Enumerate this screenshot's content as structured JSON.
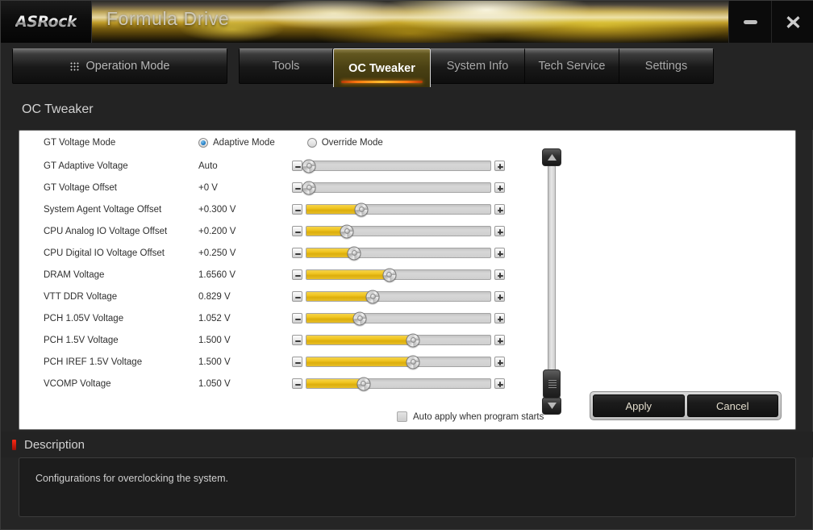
{
  "window": {
    "brand": "ASRock",
    "title": "Formula Drive",
    "minimize_label": "minimize",
    "close_label": "close"
  },
  "tabs": {
    "operation_mode": "Operation Mode",
    "items": [
      {
        "label": "Tools",
        "active": false
      },
      {
        "label": "OC Tweaker",
        "active": true
      },
      {
        "label": "System Info",
        "active": false
      },
      {
        "label": "Tech Service",
        "active": false
      },
      {
        "label": "Settings",
        "active": false
      }
    ]
  },
  "page": {
    "title": "OC Tweaker"
  },
  "mode_row": {
    "label": "GT Voltage Mode",
    "options": [
      {
        "label": "Adaptive Mode",
        "selected": true
      },
      {
        "label": "Override Mode",
        "selected": false
      }
    ]
  },
  "settings": [
    {
      "label": "GT Adaptive Voltage",
      "value": "Auto",
      "fill_pct": 0,
      "knob_pct": 1.5
    },
    {
      "label": "GT Voltage Offset",
      "value": "+0 V",
      "fill_pct": 0,
      "knob_pct": 1.5
    },
    {
      "label": "System Agent Voltage Offset",
      "value": "+0.300 V",
      "fill_pct": 30,
      "knob_pct": 30
    },
    {
      "label": "CPU Analog IO Voltage Offset",
      "value": "+0.200 V",
      "fill_pct": 22,
      "knob_pct": 22
    },
    {
      "label": "CPU Digital IO Voltage Offset",
      "value": "+0.250 V",
      "fill_pct": 26,
      "knob_pct": 26
    },
    {
      "label": "DRAM Voltage",
      "value": "1.6560 V",
      "fill_pct": 45,
      "knob_pct": 45
    },
    {
      "label": "VTT DDR Voltage",
      "value": "0.829 V",
      "fill_pct": 36,
      "knob_pct": 36
    },
    {
      "label": "PCH 1.05V Voltage",
      "value": "1.052 V",
      "fill_pct": 29,
      "knob_pct": 29
    },
    {
      "label": "PCH 1.5V Voltage",
      "value": "1.500 V",
      "fill_pct": 58,
      "knob_pct": 58
    },
    {
      "label": "PCH IREF 1.5V Voltage",
      "value": "1.500 V",
      "fill_pct": 58,
      "knob_pct": 58
    },
    {
      "label": "VCOMP Voltage",
      "value": "1.050 V",
      "fill_pct": 31,
      "knob_pct": 31
    }
  ],
  "spinner": {
    "decrement_label": "decrease",
    "increment_label": "increase"
  },
  "auto_apply": {
    "label": "Auto apply when program starts",
    "checked": false
  },
  "actions": {
    "apply": "Apply",
    "cancel": "Cancel"
  },
  "description": {
    "heading": "Description",
    "text": "Configurations for overclocking the system."
  },
  "colors": {
    "accent_gold": "#f0c520",
    "tab_active_underline": "#ff7a10",
    "panel_bg": "#ffffff",
    "chrome_bg": "#232323",
    "radio_blue": "#1675c0",
    "desc_marker_red": "#ff2a14"
  }
}
